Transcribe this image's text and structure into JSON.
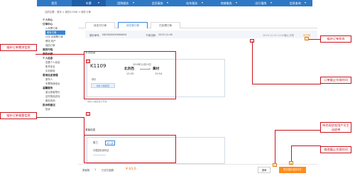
{
  "topnav": {
    "items": [
      {
        "label": "首页",
        "has_caret": false,
        "active": false
      },
      {
        "label": "车票",
        "has_caret": true,
        "active": true
      },
      {
        "label": "团购服务",
        "has_caret": true,
        "active": false
      },
      {
        "label": "会员服务",
        "has_caret": true,
        "active": false
      },
      {
        "label": "站车服务",
        "has_caret": true,
        "active": false
      },
      {
        "label": "商旅服务",
        "has_caret": true,
        "active": false
      },
      {
        "label": "出行指南",
        "has_caret": true,
        "active": false
      },
      {
        "label": "信息查询",
        "has_caret": true,
        "active": false
      }
    ]
  },
  "breadcrumb": "当前位置：首页 > 我的12306 > 候补订单",
  "sidebar": {
    "sections": [
      {
        "title": "个人中心",
        "items": []
      },
      {
        "title": "订单中心",
        "items": [
          {
            "label": "火车票订单",
            "active": false
          },
          {
            "label": "候补订单",
            "active": true
          },
          {
            "label": "计次·定期票订单",
            "active": false
          },
          {
            "label": "餐饮·特产",
            "active": false
          },
          {
            "label": "保险订单",
            "active": false
          }
        ]
      },
      {
        "title": "我的行程",
        "items": []
      },
      {
        "title": "我的余额",
        "items": []
      },
      {
        "title": "个人信息",
        "items": [
          {
            "label": "查看个人信息",
            "active": false
          },
          {
            "label": "账号安全",
            "active": false
          },
          {
            "label": "手机核验",
            "active": false
          }
        ]
      },
      {
        "title": "常用信息管理",
        "items": [
          {
            "label": "乘车人",
            "active": false
          },
          {
            "label": "车票快递地址",
            "active": false
          }
        ]
      },
      {
        "title": "温馨服务",
        "items": [
          {
            "label": "重点旅客预约",
            "active": false
          },
          {
            "label": "遗失物品查找",
            "active": false
          },
          {
            "label": "服务查询",
            "active": false
          }
        ]
      },
      {
        "title": "投诉和建议",
        "items": [
          {
            "label": "投诉",
            "active": false
          }
        ]
      }
    ]
  },
  "tabs": [
    {
      "label": "待支付订单",
      "active": false
    },
    {
      "label": "待兑现订单",
      "active": true
    },
    {
      "label": "已处理订单",
      "active": false
    }
  ],
  "order_info": {
    "order_no_label": "候补单号：",
    "order_no": "E800630049660634",
    "order_date_label": "下单日期：",
    "order_date": "2019-12-06",
    "deadline_text": "2019-12-19 12:00截止兑现",
    "status": "待兑现"
  },
  "trip": {
    "section_title": "车次信息",
    "train_no": "K1109",
    "date": "2019年12月20日",
    "from_station": "北京西",
    "to_station": "黄村",
    "depart_time": "13:35",
    "arrive_time": "13:54",
    "seat_label": "硬卧",
    "add_button": "候补人数配置",
    "tip": "*候补入数配置已开通"
  },
  "passenger": {
    "section_title": "乘客信息",
    "name": "张三",
    "badge": "成人票",
    "id_type": "中国居民身份证",
    "id_number": "************"
  },
  "bottom": {
    "count_label": "乘客数：",
    "count": "1",
    "paid_label": "已支付金额：",
    "price": "¥ 63.0",
    "cancel_button": "退单",
    "pay_button": "再次候补选择车次"
  },
  "annotations": [
    {
      "label": "候补订单需求信息",
      "badge": "1"
    },
    {
      "label": "候补订单乘客信息",
      "badge": "2"
    },
    {
      "label": "候补订单状态",
      "badge": "3"
    },
    {
      "label": "订单截止兑现时间",
      "badge": "4"
    },
    {
      "label": "待兑现状态用户可主动退单",
      "badge": "5"
    },
    {
      "label": "修改截止兑现时间",
      "badge": "6"
    }
  ],
  "colors": {
    "nav_bg": "#2f78c4",
    "accent": "#3a85d1",
    "annotation": "#c8141e",
    "price": "#ff6a00",
    "pay_button": "#ff8c1a"
  }
}
